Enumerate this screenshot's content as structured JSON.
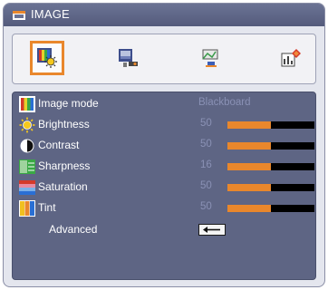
{
  "menu": {
    "title": "IMAGE",
    "tabs": [
      {
        "name": "image",
        "icon": "image-icon",
        "active": true
      },
      {
        "name": "display",
        "icon": "display-icon",
        "active": false
      },
      {
        "name": "setup",
        "icon": "setup-icon",
        "active": false
      },
      {
        "name": "options",
        "icon": "options-icon",
        "active": false
      }
    ]
  },
  "settings": {
    "image_mode": {
      "label": "Image mode",
      "value": "Blackboard",
      "icon": "image-mode-icon"
    },
    "brightness": {
      "label": "Brightness",
      "value": "50",
      "level": 0.5,
      "icon": "brightness-icon"
    },
    "contrast": {
      "label": "Contrast",
      "value": "50",
      "level": 0.5,
      "icon": "contrast-icon"
    },
    "sharpness": {
      "label": "Sharpness",
      "value": "16",
      "level": 0.5,
      "icon": "sharpness-icon"
    },
    "saturation": {
      "label": "Saturation",
      "value": "50",
      "level": 0.5,
      "icon": "saturation-icon"
    },
    "tint": {
      "label": "Tint",
      "value": "50",
      "level": 0.5,
      "icon": "tint-icon"
    },
    "advanced": {
      "label": "Advanced",
      "icon": "enter-icon"
    }
  },
  "colors": {
    "accent": "#e9872c",
    "panel": "#5e6584",
    "titlebar": "#545b7c",
    "value_text": "#8a91b5"
  }
}
